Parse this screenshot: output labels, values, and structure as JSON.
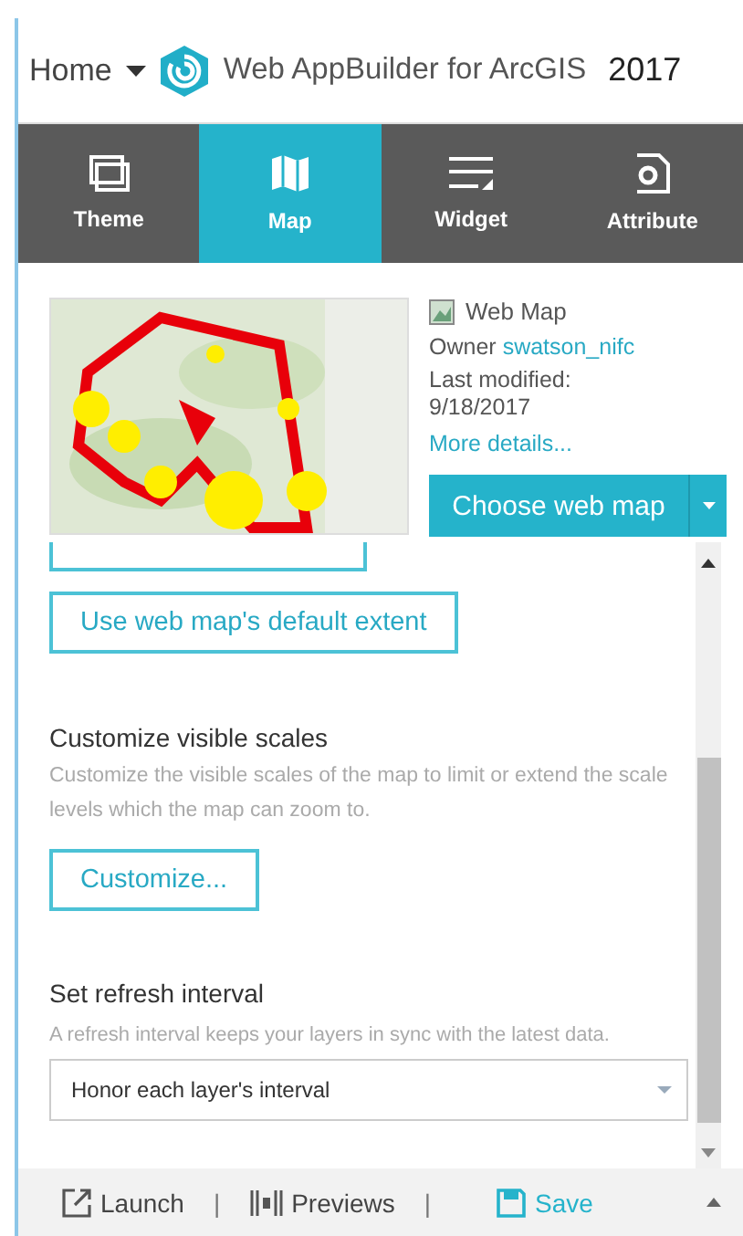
{
  "header": {
    "menu_label": "Home",
    "app_title": "Web AppBuilder for ArcGIS",
    "year": "2017"
  },
  "tabs": [
    {
      "label": "Theme",
      "kind": "theme",
      "selected": false
    },
    {
      "label": "Map",
      "kind": "map",
      "selected": true
    },
    {
      "label": "Widget",
      "kind": "widget",
      "selected": false
    },
    {
      "label": "Attribute",
      "kind": "attribute",
      "selected": false
    }
  ],
  "web_map": {
    "type_label": "Web Map",
    "owner_label": "Owner",
    "owner": "swatson_nifc",
    "modified_label": "Last modified:",
    "modified_date": "9/18/2017",
    "details_link": "More details...",
    "choose_button": "Choose web map"
  },
  "extent": {
    "button": "Use web map's default extent"
  },
  "scales": {
    "heading": "Customize visible scales",
    "description": "Customize the visible scales of the map to limit or extend the scale levels which the map can zoom to.",
    "button": "Customize..."
  },
  "refresh": {
    "heading": "Set refresh interval",
    "description": "A refresh interval keeps your layers in sync with the latest data.",
    "value": "Honor each layer's interval"
  },
  "footer": [
    {
      "kind": "launch",
      "label": "Launch"
    },
    {
      "kind": "separator",
      "label": "|"
    },
    {
      "kind": "previews",
      "label": "Previews"
    },
    {
      "kind": "separator",
      "label": "|"
    },
    {
      "kind": "save",
      "label": "Save"
    }
  ]
}
